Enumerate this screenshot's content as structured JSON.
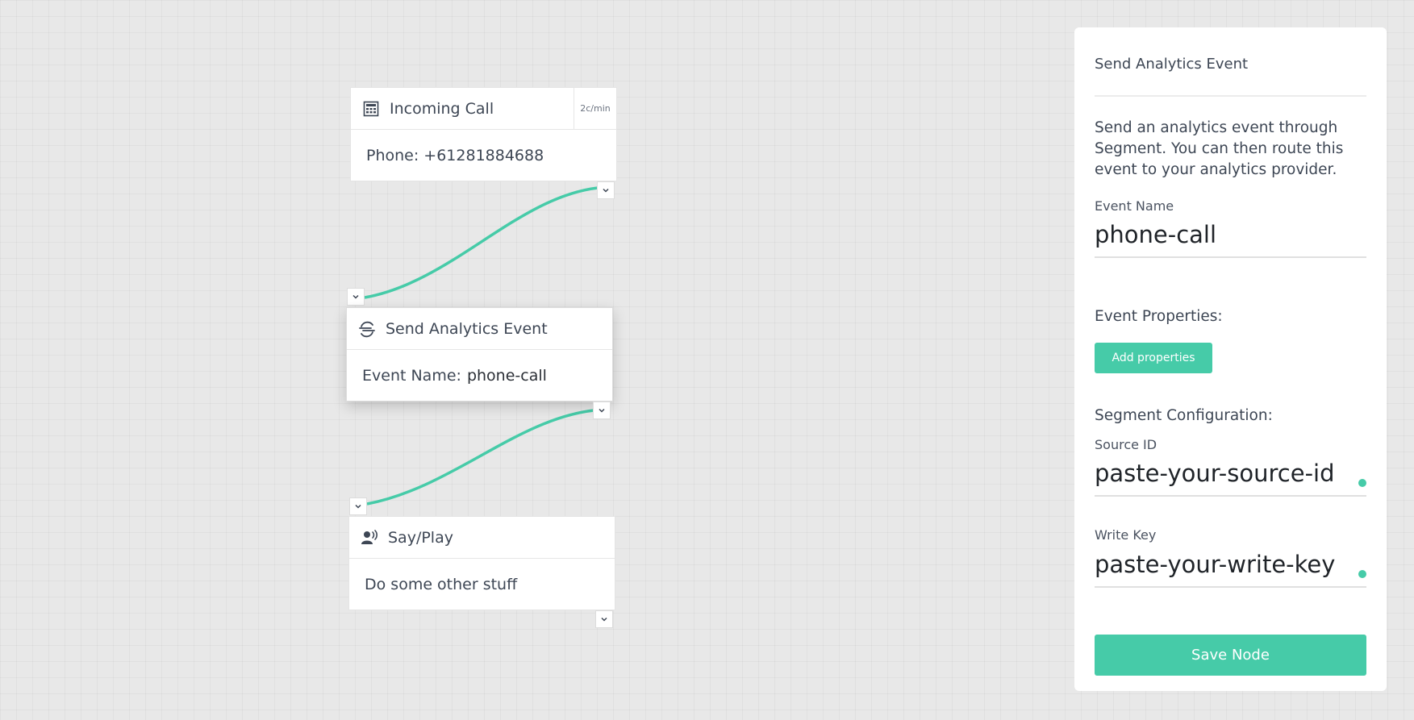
{
  "accent_color": "#46cba8",
  "nodes": {
    "incoming_call": {
      "icon": "calculator-icon",
      "title": "Incoming Call",
      "rate": "2c/min",
      "body": "Phone: +61281884688"
    },
    "send_analytics": {
      "icon": "segment-icon",
      "title": "Send Analytics Event",
      "body_label": "Event Name:",
      "body_value": "phone-call"
    },
    "say_play": {
      "icon": "speaking-person-icon",
      "title": "Say/Play",
      "body": "Do some other stuff"
    }
  },
  "panel": {
    "title": "Send Analytics Event",
    "description": "Send an analytics event through Segment. You can then route this event to your analytics provider.",
    "event_name_label": "Event Name",
    "event_name_value": "phone-call",
    "event_properties_label": "Event Properties:",
    "add_properties_label": "Add properties",
    "segment_config_label": "Segment Configuration:",
    "source_id_label": "Source ID",
    "source_id_value": "paste-your-source-id",
    "write_key_label": "Write Key",
    "write_key_value": "paste-your-write-key",
    "save_label": "Save Node"
  }
}
